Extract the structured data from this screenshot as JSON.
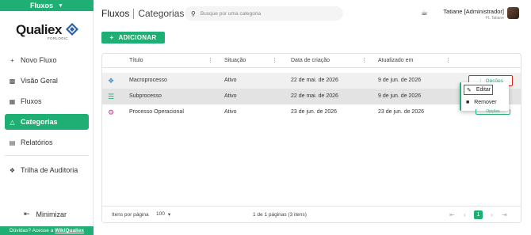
{
  "sidebar": {
    "module_label": "Fluxos",
    "logo_text": "Qualiex",
    "logo_sub": "FORLOGIC",
    "items": [
      {
        "label": "Novo Fluxo",
        "icon": "plus-icon"
      },
      {
        "label": "Visão Geral",
        "icon": "dashboard-icon"
      },
      {
        "label": "Fluxos",
        "icon": "flow-icon"
      },
      {
        "label": "Categorias",
        "icon": "categories-icon",
        "active": true
      },
      {
        "label": "Relatórios",
        "icon": "report-icon"
      },
      {
        "label": "Trilha de Auditoria",
        "icon": "audit-trail-icon"
      }
    ],
    "minimize_label": "Minimizar",
    "help_text": "Dúvidas? Acesse a ",
    "help_link": "WikiQualiex"
  },
  "header": {
    "title": "Fluxos",
    "subtitle": "Categorias",
    "search_placeholder": "Busque por uma categoria",
    "user_name": "Tatiane [Administrador]",
    "user_sub": "FL Tatiane"
  },
  "add_button_label": "ADICIONAR",
  "table": {
    "columns": [
      "Título",
      "Situação",
      "Data de criação",
      "Atualizado em"
    ],
    "rows": [
      {
        "icon": "puzzle-icon",
        "icon_color": "#3b8fd8",
        "title": "Macroprocesso",
        "status": "Ativo",
        "created": "22 de mai. de 2026",
        "updated": "9 de jun. de 2026"
      },
      {
        "icon": "list-icon",
        "icon_color": "#1fae73",
        "title": "Subprocesso",
        "status": "Ativo",
        "created": "22 de mai. de 2026",
        "updated": "9 de jun. de 2026"
      },
      {
        "icon": "gear-icon",
        "icon_color": "#d63384",
        "title": "Processo Operacional",
        "status": "Ativo",
        "created": "23 de jun. de 2026",
        "updated": "23 de jun. de 2026"
      }
    ],
    "options_label": "Opções"
  },
  "pager": {
    "per_page_label": "Itens por página",
    "per_page_value": "100",
    "range_text": "1 de 1 páginas (3 itens)",
    "current_page": "1"
  },
  "menu": {
    "edit_label": "Editar",
    "remove_label": "Remover"
  },
  "colors": {
    "accent": "#1fae73",
    "highlight": "#d8281c"
  }
}
